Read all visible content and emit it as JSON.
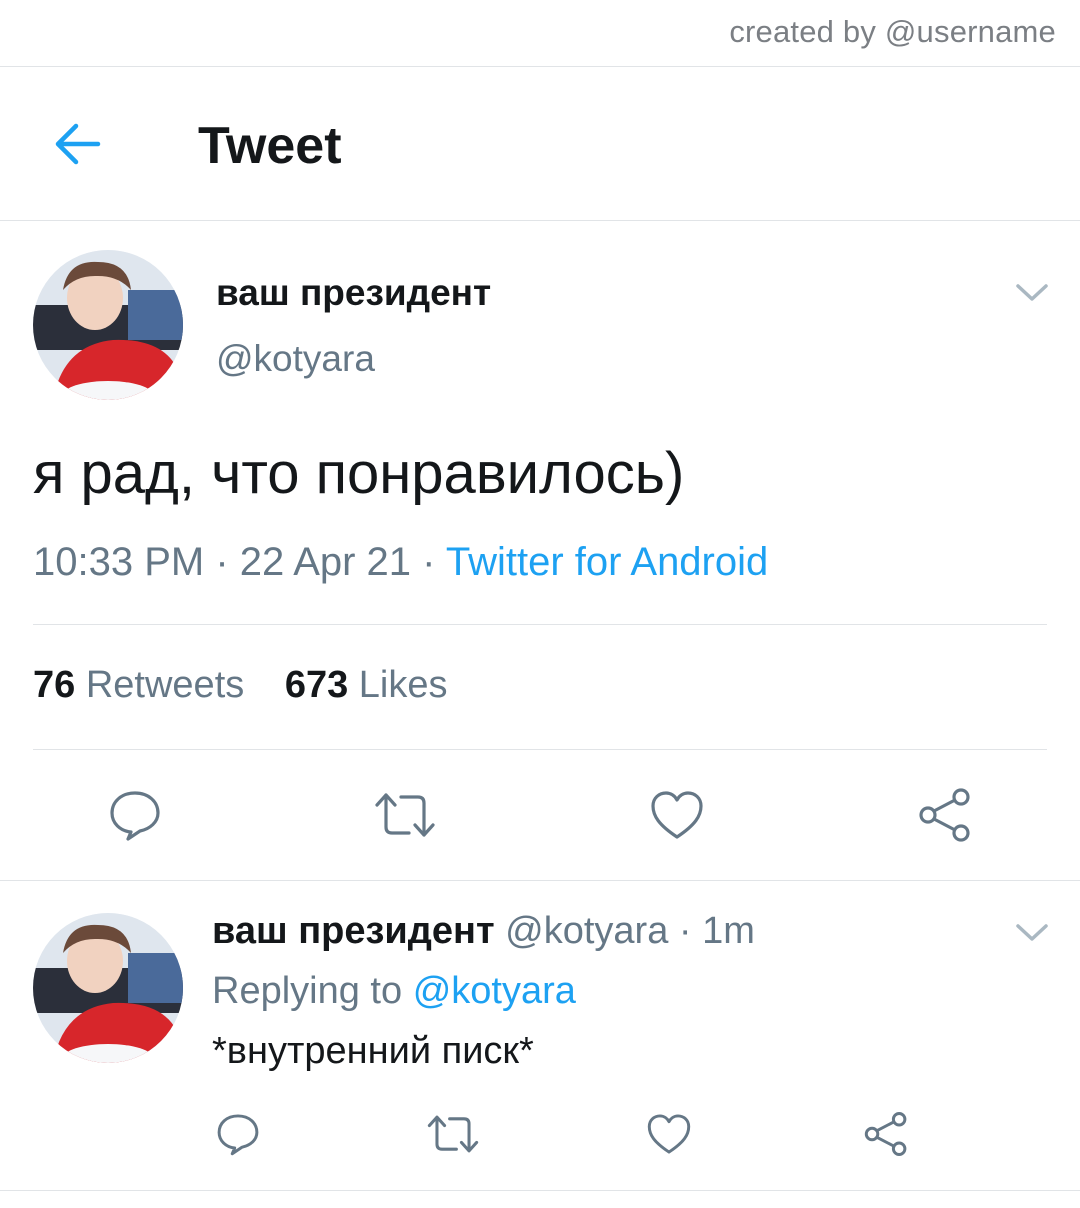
{
  "watermark": "created by @username",
  "header": {
    "title": "Tweet"
  },
  "main_tweet": {
    "display_name": "ваш президент",
    "handle": "@kotyara",
    "text": "я рад, что понравилось)",
    "time": "10:33 PM",
    "date": "22 Apr 21",
    "separator": "·",
    "source": "Twitter for Android",
    "retweets_count": "76",
    "retweets_label": "Retweets",
    "likes_count": "673",
    "likes_label": "Likes"
  },
  "reply_tweet": {
    "display_name": "ваш президент",
    "handle": "@kotyara",
    "separator": "·",
    "time_ago": "1m",
    "replying_prefix": "Replying to",
    "replying_to": "@kotyara",
    "text": "*внутренний писк*"
  },
  "icons": [
    "back-arrow-icon",
    "chevron-down-icon",
    "reply-icon",
    "retweet-icon",
    "like-icon",
    "share-icon"
  ],
  "colors": {
    "accent": "#1da1f2",
    "secondary_text": "#657786",
    "divider": "#e1e4e7"
  }
}
